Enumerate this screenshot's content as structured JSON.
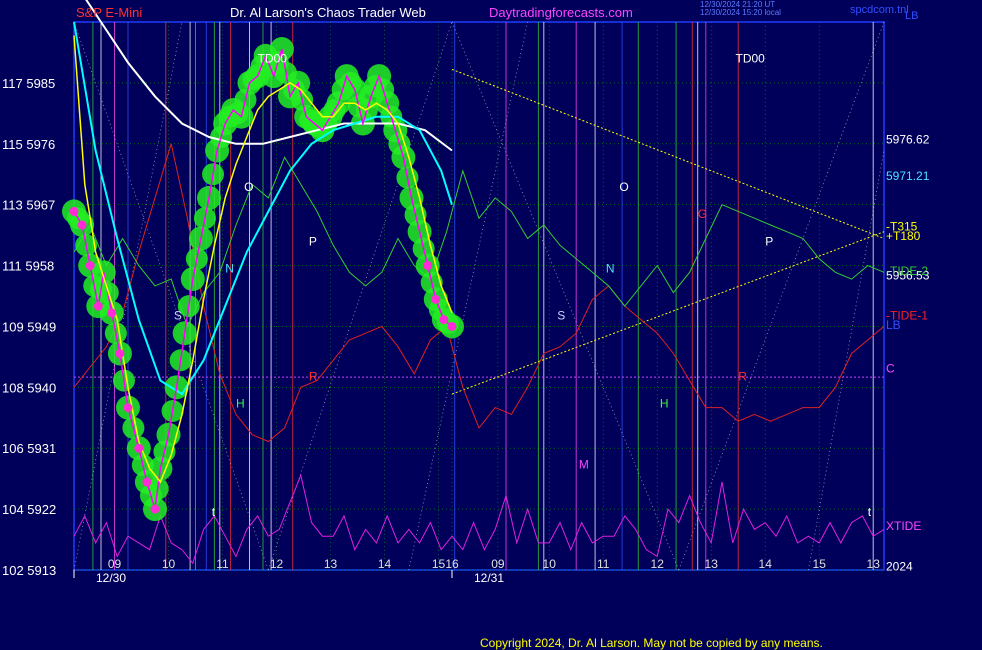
{
  "header": {
    "symbol": "S&P E-Mini",
    "author": "Dr. Al Larson's Chaos Trader Web",
    "site": "Daytradingforecasts.com",
    "stamp_line1": "12/30/2024 21:20 UT",
    "stamp_line2": "12/30/2024 15:20 local",
    "right_tag": "spcdcom.tnl",
    "right_tag2": "LB"
  },
  "copyright": "Copyright 2024, Dr. Al Larson. May not be copied by any means.",
  "colors": {
    "background": "#00005a",
    "price": "#ff00ff",
    "fast_ma": "#ffff00",
    "mid_ma": "#00ffff",
    "slow_ma": "#ffffff",
    "tide2": "#33cc33",
    "tide1": "#e02020",
    "xtide": "#e020e0",
    "halo": "#22ee22",
    "dots": "#ff2bd6"
  },
  "chart_data": {
    "type": "line",
    "x_axis": {
      "day_labels": [
        {
          "label": "12/30",
          "hour": 9.0
        },
        {
          "label": "12/31",
          "hour": 16.0
        }
      ],
      "hour_ticks": [
        {
          "label": "09",
          "hour": 9.75
        },
        {
          "label": "10",
          "hour": 10.75
        },
        {
          "label": "11",
          "hour": 11.75
        },
        {
          "label": "12",
          "hour": 12.75
        },
        {
          "label": "13",
          "hour": 13.75
        },
        {
          "label": "14",
          "hour": 14.75
        },
        {
          "label": "15",
          "hour": 15.75
        },
        {
          "label": "16",
          "hour": 16.0
        },
        {
          "label": "09",
          "hour": 16.85
        },
        {
          "label": "10",
          "hour": 17.8
        },
        {
          "label": "11",
          "hour": 18.8
        },
        {
          "label": "12",
          "hour": 19.8
        },
        {
          "label": "13",
          "hour": 20.8
        },
        {
          "label": "14",
          "hour": 21.8
        },
        {
          "label": "15",
          "hour": 22.8
        },
        {
          "label": "13",
          "hour": 23.8
        }
      ],
      "range": [
        9.0,
        24.0
      ]
    },
    "y_axis": {
      "range": [
        5913,
        5994
      ],
      "ticks": [
        {
          "price": 5913,
          "label": "102 5913"
        },
        {
          "price": 5922,
          "label": "104 5922"
        },
        {
          "price": 5931,
          "label": "106 5931"
        },
        {
          "price": 5940,
          "label": "108 5940"
        },
        {
          "price": 5949,
          "label": "109 5949"
        },
        {
          "price": 5958,
          "label": "111 5958"
        },
        {
          "price": 5967,
          "label": "113 5967"
        },
        {
          "price": 5976,
          "label": "115 5976"
        },
        {
          "price": 5985,
          "label": "117 5985"
        }
      ]
    },
    "series": [
      {
        "key": "price",
        "x": [
          9.0,
          9.15,
          9.3,
          9.45,
          9.55,
          9.7,
          9.85,
          10.0,
          10.2,
          10.35,
          10.5,
          10.6,
          10.75,
          10.9,
          11.05,
          11.2,
          11.35,
          11.5,
          11.65,
          11.8,
          11.95,
          12.1,
          12.25,
          12.4,
          12.55,
          12.7,
          12.85,
          13.0,
          13.15,
          13.3,
          13.45,
          13.6,
          13.75,
          13.9,
          14.05,
          14.2,
          14.35,
          14.5,
          14.65,
          14.8,
          14.95,
          15.1,
          15.25,
          15.4,
          15.55,
          15.7,
          15.85,
          16.0
        ],
        "y": [
          5966,
          5964,
          5958,
          5952,
          5957,
          5951,
          5945,
          5937,
          5931,
          5926,
          5922,
          5928,
          5933,
          5940,
          5948,
          5956,
          5962,
          5968,
          5975,
          5979,
          5981,
          5980,
          5985,
          5986,
          5989,
          5986,
          5990,
          5983,
          5985,
          5980,
          5979,
          5978,
          5980,
          5982,
          5986,
          5984,
          5979,
          5983,
          5986,
          5982,
          5978,
          5974,
          5968,
          5963,
          5958,
          5953,
          5950,
          5949
        ]
      },
      {
        "key": "fast_ma",
        "x": [
          9.0,
          9.2,
          9.4,
          9.6,
          9.8,
          10.0,
          10.2,
          10.4,
          10.6,
          10.8,
          11.0,
          11.2,
          11.4,
          11.6,
          11.8,
          12.0,
          12.2,
          12.4,
          12.6,
          12.8,
          13.0,
          13.2,
          13.4,
          13.6,
          13.8,
          14.0,
          14.2,
          14.4,
          14.6,
          14.8,
          15.0,
          15.2,
          15.4,
          15.6,
          15.8,
          16.0
        ],
        "y": [
          5992,
          5970,
          5960,
          5955,
          5950,
          5940,
          5932,
          5928,
          5926,
          5930,
          5936,
          5944,
          5953,
          5961,
          5968,
          5973,
          5977,
          5981,
          5983,
          5984,
          5985,
          5984,
          5982,
          5980,
          5980,
          5982,
          5982,
          5981,
          5982,
          5981,
          5979,
          5974,
          5968,
          5961,
          5955,
          5951
        ]
      },
      {
        "key": "mid_ma",
        "x": [
          9.0,
          9.4,
          9.8,
          10.2,
          10.6,
          11.0,
          11.4,
          11.8,
          12.2,
          12.6,
          13.0,
          13.4,
          13.8,
          14.2,
          14.6,
          15.0,
          15.4,
          15.8,
          16.0
        ],
        "y": [
          5994,
          5975,
          5962,
          5950,
          5941,
          5939,
          5944,
          5952,
          5960,
          5966,
          5972,
          5976,
          5978,
          5979,
          5980,
          5980,
          5978,
          5972,
          5967
        ]
      },
      {
        "key": "slow_ma",
        "x": [
          9.0,
          9.5,
          10.0,
          10.5,
          11.0,
          11.5,
          12.0,
          12.5,
          13.0,
          13.5,
          14.0,
          14.5,
          15.0,
          15.5,
          16.0
        ],
        "y": [
          6000,
          5994,
          5988,
          5983,
          5979,
          5977,
          5976,
          5976,
          5977,
          5978,
          5979,
          5979,
          5979,
          5978,
          5975
        ]
      },
      {
        "key": "tide2",
        "x": [
          9.0,
          9.3,
          9.6,
          9.9,
          10.2,
          10.5,
          10.8,
          11.1,
          11.4,
          11.7,
          12.0,
          12.3,
          12.6,
          12.9,
          13.2,
          13.5,
          13.8,
          14.1,
          14.4,
          14.7,
          15.0,
          15.3,
          15.6,
          15.9,
          16.2,
          16.5,
          16.8,
          17.1,
          17.4,
          17.7,
          18.0,
          18.3,
          18.6,
          18.9,
          19.2,
          19.5,
          19.8,
          20.1,
          20.4,
          20.7,
          21.0,
          21.3,
          21.6,
          21.9,
          22.2,
          22.5,
          22.8,
          23.1,
          23.4,
          23.7,
          24.0
        ],
        "y": [
          5960,
          5964,
          5958,
          5962,
          5958,
          5955,
          5956,
          5949,
          5954,
          5957,
          5964,
          5970,
          5968,
          5974,
          5970,
          5966,
          5961,
          5957,
          5955,
          5957,
          5962,
          5958,
          5956,
          5963,
          5972,
          5965,
          5968,
          5966,
          5962,
          5964,
          5961,
          5959,
          5957,
          5955,
          5952,
          5955,
          5958,
          5954,
          5957,
          5962,
          5967,
          5966,
          5965,
          5964,
          5963,
          5962,
          5959,
          5957,
          5956,
          5958,
          5957
        ]
      },
      {
        "key": "tide1",
        "x": [
          9.0,
          9.3,
          9.6,
          9.9,
          10.2,
          10.5,
          10.8,
          11.1,
          11.4,
          11.7,
          12.0,
          12.3,
          12.6,
          12.9,
          13.2,
          13.5,
          13.8,
          14.1,
          14.4,
          14.7,
          15.0,
          15.3,
          15.6,
          15.9,
          16.2,
          16.5,
          16.8,
          17.1,
          17.4,
          17.7,
          18.0,
          18.3,
          18.6,
          18.9,
          19.2,
          19.5,
          19.8,
          20.1,
          20.4,
          20.7,
          21.0,
          21.3,
          21.6,
          21.9,
          22.2,
          22.5,
          22.8,
          23.1,
          23.4,
          23.7,
          24.0
        ],
        "y": [
          5940,
          5943,
          5946,
          5951,
          5960,
          5968,
          5976,
          5965,
          5952,
          5942,
          5936,
          5933,
          5932,
          5934,
          5940,
          5941,
          5944,
          5947,
          5948,
          5949,
          5946,
          5942,
          5947,
          5949,
          5940,
          5934,
          5937,
          5936,
          5940,
          5945,
          5946,
          5948,
          5953,
          5955,
          5952,
          5950,
          5948,
          5945,
          5941,
          5937,
          5937,
          5935,
          5936,
          5935,
          5936,
          5937,
          5937,
          5940,
          5945,
          5947,
          5949
        ]
      },
      {
        "key": "xtide",
        "x": [
          9.0,
          9.2,
          9.4,
          9.6,
          9.8,
          10.0,
          10.2,
          10.4,
          10.6,
          10.8,
          11.0,
          11.2,
          11.4,
          11.6,
          11.8,
          12.0,
          12.2,
          12.4,
          12.6,
          12.8,
          13.0,
          13.2,
          13.4,
          13.6,
          13.8,
          14.0,
          14.2,
          14.4,
          14.6,
          14.8,
          15.0,
          15.2,
          15.4,
          15.6,
          15.8,
          16.0,
          16.2,
          16.4,
          16.6,
          16.8,
          17.0,
          17.2,
          17.4,
          17.6,
          17.8,
          18.0,
          18.2,
          18.4,
          18.6,
          18.8,
          19.0,
          19.2,
          19.4,
          19.6,
          19.8,
          20.0,
          20.2,
          20.4,
          20.6,
          20.8,
          21.0,
          21.2,
          21.4,
          21.6,
          21.8,
          22.0,
          22.2,
          22.4,
          22.6,
          22.8,
          23.0,
          23.2,
          23.4,
          23.6,
          23.8,
          24.0
        ],
        "y": [
          5918,
          5921,
          5917,
          5920,
          5915,
          5918,
          5917,
          5916,
          5921,
          5917,
          5916,
          5914,
          5919,
          5921,
          5918,
          5915,
          5919,
          5921,
          5918,
          5919,
          5923,
          5927,
          5920,
          5918,
          5918,
          5921,
          5916,
          5919,
          5917,
          5921,
          5917,
          5919,
          5917,
          5920,
          5916,
          5918,
          5916,
          5920,
          5916,
          5919,
          5924,
          5917,
          5922,
          5917,
          5917,
          5920,
          5916,
          5920,
          5917,
          5918,
          5918,
          5921,
          5919,
          5916,
          5915,
          5922,
          5920,
          5924,
          5920,
          5917,
          5926,
          5917,
          5922,
          5919,
          5920,
          5918,
          5921,
          5917,
          5918,
          5917,
          5920,
          5917,
          5920,
          5921,
          5918,
          5919
        ]
      }
    ],
    "annotations": [
      {
        "text": "TD00",
        "hour": 12.4,
        "price": 5988,
        "color": "#ffffff"
      },
      {
        "text": "TD00",
        "hour": 21.25,
        "price": 5988,
        "color": "#ffffff"
      },
      {
        "text": "O",
        "hour": 12.15,
        "price": 5969,
        "color": "#ffffff"
      },
      {
        "text": "O",
        "hour": 19.1,
        "price": 5969,
        "color": "#ffffff"
      },
      {
        "text": "P",
        "hour": 13.35,
        "price": 5961,
        "color": "#ffffff"
      },
      {
        "text": "P",
        "hour": 21.8,
        "price": 5961,
        "color": "#ffffff"
      },
      {
        "text": "N",
        "hour": 11.8,
        "price": 5957,
        "color": "#4de4ff"
      },
      {
        "text": "N",
        "hour": 18.85,
        "price": 5957,
        "color": "#4de4ff"
      },
      {
        "text": "S",
        "hour": 10.85,
        "price": 5950,
        "color": "#d0d0ff"
      },
      {
        "text": "S",
        "hour": 17.95,
        "price": 5950,
        "color": "#d0d0ff"
      },
      {
        "text": "R",
        "hour": 13.35,
        "price": 5941,
        "color": "#ff3030"
      },
      {
        "text": "R",
        "hour": 21.3,
        "price": 5941,
        "color": "#ff3030"
      },
      {
        "text": "H",
        "hour": 12.0,
        "price": 5937,
        "color": "#33ff33"
      },
      {
        "text": "H",
        "hour": 19.85,
        "price": 5937,
        "color": "#33ff33"
      },
      {
        "text": "M",
        "hour": 18.35,
        "price": 5928,
        "color": "#ff44ff"
      },
      {
        "text": "G",
        "hour": 20.55,
        "price": 5965,
        "color": "#ff3030"
      },
      {
        "text": "t",
        "hour": 11.55,
        "price": 5921,
        "color": "#ffffff"
      },
      {
        "text": "t",
        "hour": 23.7,
        "price": 5921,
        "color": "#ffffff"
      }
    ],
    "right_labels": [
      {
        "text": "5976.62",
        "price": 5976.62,
        "color": "#ffffff"
      },
      {
        "text": "5971.21",
        "price": 5971.21,
        "color": "#4de4ff"
      },
      {
        "text": "-T315",
        "price": 5963.8,
        "color": "#ffff00"
      },
      {
        "text": "+T180",
        "price": 5962.4,
        "color": "#ffff00"
      },
      {
        "text": "5956.53",
        "price": 5956.53,
        "color": "#ffffff"
      },
      {
        "text": "-TIDE-2",
        "price": 5957.2,
        "color": "#33cc33"
      },
      {
        "text": "-TIDE-1",
        "price": 5950.6,
        "color": "#ff2020"
      },
      {
        "text": "LB",
        "price": 5949.2,
        "color": "#3050ff"
      },
      {
        "text": "C",
        "price": 5942.8,
        "color": "#ff44ff"
      },
      {
        "text": "XTIDE",
        "price": 5919.5,
        "color": "#ff44ff"
      },
      {
        "text": "2024",
        "price": 5913.5,
        "color": "#ffffff"
      }
    ],
    "trendlines": [
      {
        "x1": 16.0,
        "y1": 5987,
        "x2": 24.0,
        "y2": 5962
      },
      {
        "x1": 16.0,
        "y1": 5939,
        "x2": 24.0,
        "y2": 5963
      }
    ],
    "reference_line": {
      "price": 5941.5,
      "color": "#cc44ff"
    }
  }
}
